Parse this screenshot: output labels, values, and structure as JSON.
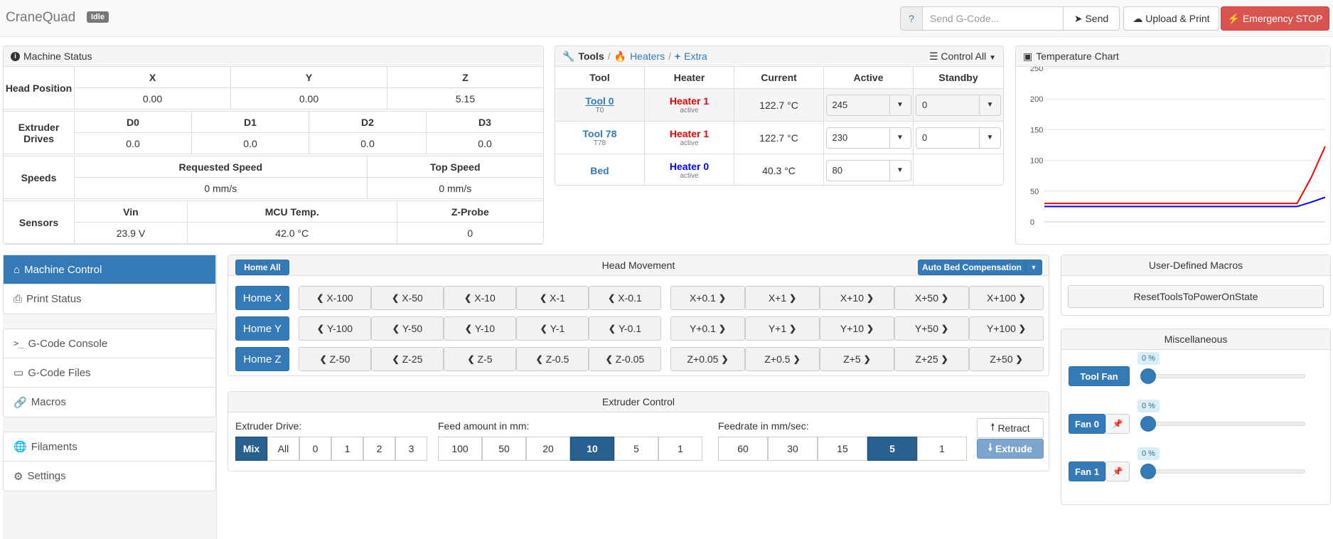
{
  "navbar": {
    "brand": "CraneQuad",
    "status": "Idle",
    "gcode_help": "?",
    "gcode_placeholder": "Send G-Code...",
    "send_label": "Send",
    "upload_label": "Upload & Print",
    "estop_label": "Emergency STOP",
    "estop_color": "#d9534f"
  },
  "machine_status": {
    "title": "Machine Status",
    "head_position": {
      "label": "Head Position",
      "axes": [
        "X",
        "Y",
        "Z"
      ],
      "values": [
        "0.00",
        "0.00",
        "5.15"
      ]
    },
    "extruder_drives": {
      "label": "Extruder Drives",
      "drives": [
        "D0",
        "D1",
        "D2",
        "D3"
      ],
      "values": [
        "0.0",
        "0.0",
        "0.0",
        "0.0"
      ]
    },
    "speeds": {
      "label": "Speeds",
      "headers": [
        "Requested Speed",
        "Top Speed"
      ],
      "values": [
        "0 mm/s",
        "0 mm/s"
      ]
    },
    "sensors": {
      "label": "Sensors",
      "headers": [
        "Vin",
        "MCU Temp.",
        "Z-Probe"
      ],
      "values": [
        "23.9 V",
        "42.0 °C",
        "0"
      ]
    }
  },
  "tools": {
    "tab_tools": "Tools",
    "sep": "/",
    "tab_heaters": "Heaters",
    "tab_extra": "Extra",
    "control_all": "Control All",
    "headers": [
      "Tool",
      "Heater",
      "Current",
      "Active",
      "Standby"
    ],
    "rows": [
      {
        "tool": "Tool 0",
        "sub": "T0",
        "heater": "Heater 1",
        "heater_state": "active",
        "current": "122.7 °C",
        "active": "245",
        "standby": "0"
      },
      {
        "tool": "Tool 78",
        "sub": "T78",
        "heater": "Heater 1",
        "heater_state": "active",
        "current": "122.7 °C",
        "active": "230",
        "standby": "0"
      },
      {
        "tool": "Bed",
        "sub": "",
        "heater": "Heater 0",
        "heater_state": "active",
        "current": "40.3 °C",
        "active": "80",
        "standby": ""
      }
    ]
  },
  "temperature_chart": {
    "title": "Temperature Chart"
  },
  "chart_data": {
    "type": "line",
    "title": "",
    "ylim": [
      0,
      250
    ],
    "yticks": [
      "250",
      "200",
      "150",
      "100",
      "50",
      "0"
    ],
    "grid": true,
    "x": [
      0,
      1,
      2,
      3,
      4,
      5,
      6,
      7,
      8,
      9,
      10,
      11,
      12,
      13,
      14,
      15,
      16,
      17,
      18,
      19,
      20
    ],
    "series": [
      {
        "color": "#ff0000",
        "values": [
          30,
          30,
          30,
          30,
          30,
          30,
          30,
          30,
          30,
          30,
          30,
          30,
          30,
          30,
          30,
          30,
          30,
          30,
          30,
          72,
          123
        ]
      },
      {
        "color": "#0000ff",
        "values": [
          25,
          25,
          25,
          25,
          25,
          25,
          25,
          25,
          25,
          25,
          25,
          25,
          25,
          25,
          25,
          25,
          25,
          25,
          25,
          32,
          40
        ]
      }
    ]
  },
  "sidebar": {
    "groups": [
      [
        {
          "label": "Machine Control",
          "icon": "home-icon",
          "active": true
        },
        {
          "label": "Print Status",
          "icon": "printer-icon"
        }
      ],
      [
        {
          "label": "G-Code Console",
          "icon": "terminal-icon"
        },
        {
          "label": "G-Code Files",
          "icon": "hdd-icon"
        },
        {
          "label": "Macros",
          "icon": "link-icon"
        }
      ],
      [
        {
          "label": "Filaments",
          "icon": "globe-icon"
        },
        {
          "label": "Settings",
          "icon": "gear-icon"
        }
      ]
    ]
  },
  "head_movement": {
    "title": "Head Movement",
    "home_all": "Home All",
    "auto_bed": "Auto Bed Compensation",
    "home_buttons": [
      "Home X",
      "Home Y",
      "Home Z"
    ],
    "rows": [
      {
        "neg": [
          "X-100",
          "X-50",
          "X-10",
          "X-1",
          "X-0.1"
        ],
        "pos": [
          "X+0.1",
          "X+1",
          "X+10",
          "X+50",
          "X+100"
        ]
      },
      {
        "neg": [
          "Y-100",
          "Y-50",
          "Y-10",
          "Y-1",
          "Y-0.1"
        ],
        "pos": [
          "Y+0.1",
          "Y+1",
          "Y+10",
          "Y+50",
          "Y+100"
        ]
      },
      {
        "neg": [
          "Z-50",
          "Z-25",
          "Z-5",
          "Z-0.5",
          "Z-0.05"
        ],
        "pos": [
          "Z+0.05",
          "Z+0.5",
          "Z+5",
          "Z+25",
          "Z+50"
        ]
      }
    ]
  },
  "extruder_control": {
    "title": "Extruder Control",
    "drive_label": "Extruder Drive:",
    "drives": [
      "Mix",
      "All",
      "0",
      "1",
      "2",
      "3"
    ],
    "drive_active": 0,
    "feed_label": "Feed amount in mm:",
    "feeds": [
      "100",
      "50",
      "20",
      "10",
      "5",
      "1"
    ],
    "feed_active": 3,
    "rate_label": "Feedrate in mm/sec:",
    "rates": [
      "60",
      "30",
      "15",
      "5",
      "1"
    ],
    "rate_active": 3,
    "retract": "Retract",
    "extrude": "Extrude"
  },
  "macros": {
    "title": "User-Defined Macros",
    "items": [
      "ResetToolsToPowerOnState"
    ]
  },
  "misc": {
    "title": "Miscellaneous",
    "fans": [
      {
        "label": "Tool Fan",
        "pct": "0 %",
        "level": 0,
        "pin": false
      },
      {
        "label": "Fan 0",
        "pct": "0 %",
        "level": 0,
        "pin": true
      },
      {
        "label": "Fan 1",
        "pct": "0 %",
        "level": 0,
        "pin": true
      }
    ]
  }
}
